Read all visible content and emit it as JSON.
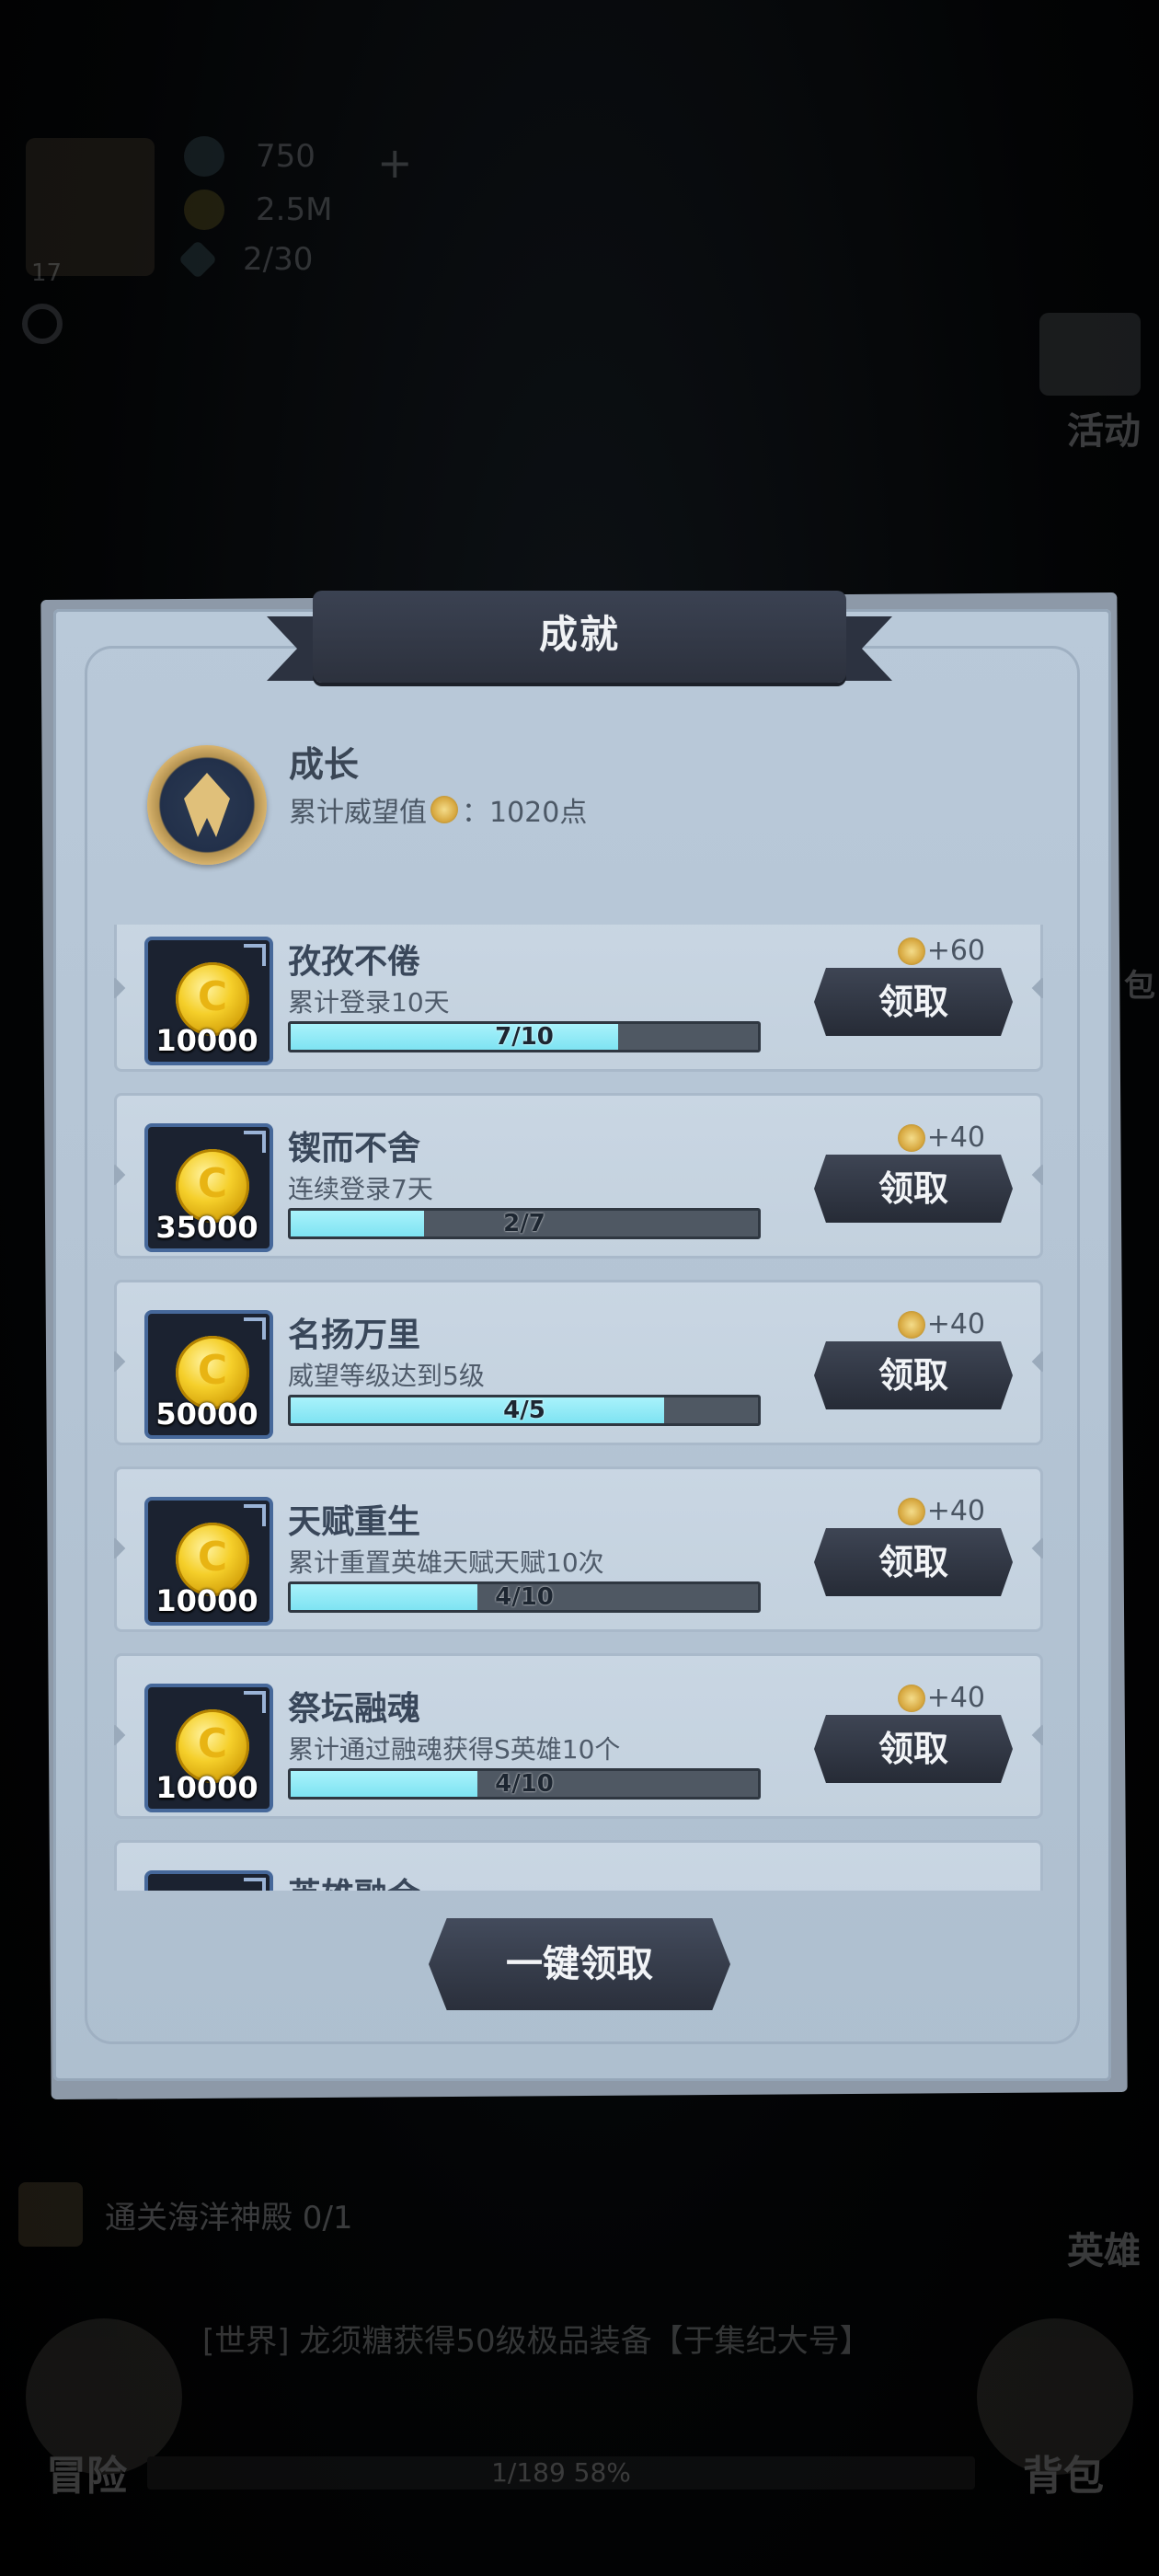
{
  "hud": {
    "level": "17",
    "diamonds": "750",
    "gold": "2.5M",
    "energy": "2/30"
  },
  "side_nav": {
    "activity": "活动",
    "hero": "英雄",
    "bag_small": "包"
  },
  "bottom": {
    "quest_text": "通关海洋神殿 0/1",
    "news_text": "[世界] 龙须糖获得50级极品装备【于集纪大号】",
    "progress_text": "1/189 58%",
    "adventure": "冒险",
    "bag": "背包"
  },
  "panel": {
    "title": "成就",
    "category_name": "成长",
    "prestige_label": "累计威望值",
    "prestige_value": "：1020点",
    "claim_all": "一键领取"
  },
  "achievements": [
    {
      "title": "孜孜不倦",
      "desc": "累计登录10天",
      "reward": "10000",
      "progress_text": "7/10",
      "progress": 0.7,
      "points": "+60",
      "button": "领取"
    },
    {
      "title": "锲而不舍",
      "desc": "连续登录7天",
      "reward": "35000",
      "progress_text": "2/7",
      "progress": 0.2857,
      "points": "+40",
      "button": "领取"
    },
    {
      "title": "名扬万里",
      "desc": "威望等级达到5级",
      "reward": "50000",
      "progress_text": "4/5",
      "progress": 0.8,
      "points": "+40",
      "button": "领取"
    },
    {
      "title": "天赋重生",
      "desc": "累计重置英雄天赋天赋10次",
      "reward": "10000",
      "progress_text": "4/10",
      "progress": 0.4,
      "points": "+40",
      "button": "领取"
    },
    {
      "title": "祭坛融魂",
      "desc": "累计通过融魂获得S英雄10个",
      "reward": "10000",
      "progress_text": "4/10",
      "progress": 0.4,
      "points": "+40",
      "button": "领取"
    },
    {
      "title": "英雄融合",
      "desc": "",
      "reward": "",
      "progress_text": "",
      "progress": 0,
      "points": "",
      "button": ""
    }
  ],
  "colors": {
    "panel_bg": "#b9c9d9",
    "progress_fill": "#7ee3f2",
    "button_dark": "#2a2f3b",
    "ribbon": "#2c313d"
  }
}
